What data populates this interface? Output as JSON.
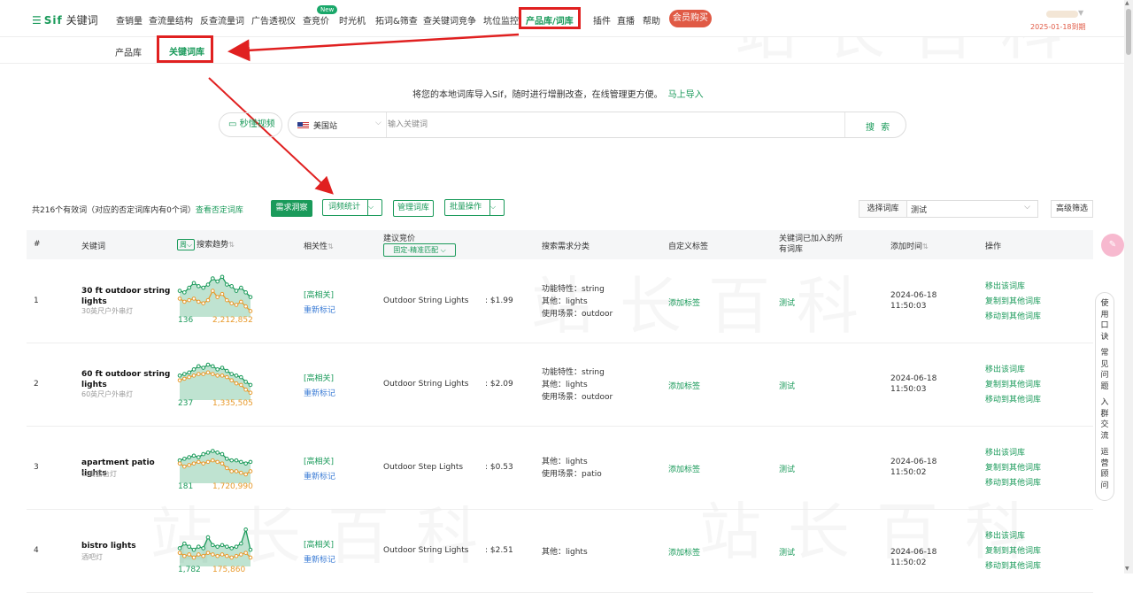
{
  "nav": {
    "logo_brand": "Sif",
    "logo_text": "关键词",
    "items": [
      "查销量",
      "查流量结构",
      "反查流量词",
      "广告透视仪",
      "查竞价",
      "时光机",
      "拓词&筛查",
      "查关键词竞争",
      "坑位监控",
      "产品库/词库",
      "插件",
      "直播",
      "帮助"
    ],
    "active_item": "产品库/词库",
    "new_badge": "New",
    "vip_button": "会员购买",
    "expire_text": "2025-01-18到期"
  },
  "subnav": {
    "items": [
      "产品库",
      "关键词库"
    ],
    "active": "关键词库"
  },
  "import_banner": {
    "text": "将您的本地词库导入Sif，随时进行增删改查，在线管理更方便。",
    "link": "马上导入"
  },
  "search": {
    "video_button": "秒懂视频",
    "site": "美国站",
    "placeholder": "输入关键词",
    "button": "搜 索"
  },
  "toolbar": {
    "total_text": "共216个有效词（对应的否定词库内有0个词）",
    "negative_link": "查看否定词库",
    "btn_demand": "需求洞察",
    "btn_freq": "词频统计",
    "btn_manage": "管理词库",
    "btn_batch": "批量操作",
    "select_label": "选择词库",
    "select_value": "测试",
    "advanced": "高级筛选"
  },
  "table": {
    "headers": {
      "index": "#",
      "keyword": "关键词",
      "trend_period": "周",
      "trend": "搜索趋势",
      "relevance": "相关性",
      "bid": "建议竞价",
      "bid_mode": "固定-精准匹配",
      "demand": "搜索需求分类",
      "tags": "自定义标签",
      "libs": "关键词已加入的所有词库",
      "added": "添加时间",
      "ops": "操作"
    },
    "rows": [
      {
        "index": "1",
        "keyword": "30 ft outdoor string lights",
        "keyword_cn": "30英尺户外串灯",
        "rank": "136",
        "volume": "2,212,852",
        "trend_green": [
          30,
          28,
          34,
          40,
          36,
          34,
          38,
          46,
          42,
          48,
          38,
          36,
          30,
          34,
          28,
          22
        ],
        "trend_orange": [
          20,
          16,
          18,
          20,
          16,
          14,
          18,
          30,
          22,
          26,
          18,
          14,
          12,
          16,
          10,
          4
        ],
        "relevance": "[高相关]",
        "remark": "重新标记",
        "category": "Outdoor String Lights",
        "bid": "$1.99",
        "demand": [
          "功能特性：string",
          "其他：lights",
          "使用场景：outdoor"
        ],
        "tag": "添加标签",
        "lib": "测试",
        "date": "2024-06-18",
        "time": "11:50:03"
      },
      {
        "index": "2",
        "keyword": "60 ft outdoor string lights",
        "keyword_cn": "60英尺户外串灯",
        "rank": "237",
        "volume": "1,335,505",
        "trend_green": [
          28,
          30,
          32,
          36,
          40,
          38,
          42,
          40,
          36,
          38,
          34,
          30,
          28,
          26,
          20,
          16
        ],
        "trend_orange": [
          22,
          24,
          26,
          28,
          30,
          30,
          32,
          30,
          28,
          28,
          26,
          22,
          18,
          16,
          10,
          6
        ],
        "relevance": "[高相关]",
        "remark": "重新标记",
        "category": "Outdoor String Lights",
        "bid": "$2.09",
        "demand": [
          "功能特性：string",
          "其他：lights",
          "使用场景：outdoor"
        ],
        "tag": "添加标签",
        "lib": "测试",
        "date": "2024-06-18",
        "time": "11:50:03"
      },
      {
        "index": "3",
        "keyword": "apartment patio lights",
        "keyword_cn": "公寓露台灯",
        "rank": "181",
        "volume": "1,720,990",
        "trend_green": [
          26,
          28,
          30,
          32,
          30,
          34,
          36,
          38,
          36,
          34,
          28,
          26,
          26,
          24,
          22,
          24
        ],
        "trend_orange": [
          22,
          18,
          20,
          22,
          24,
          22,
          24,
          26,
          24,
          22,
          16,
          12,
          12,
          10,
          8,
          12
        ],
        "relevance": "[高相关]",
        "remark": "重新标记",
        "category": "Outdoor Step Lights",
        "bid": "$0.53",
        "demand": [
          "其他：lights",
          "使用场景：patio"
        ],
        "tag": "添加标签",
        "lib": "测试",
        "date": "2024-06-18",
        "time": "11:50:02"
      },
      {
        "index": "4",
        "keyword": "bistro lights",
        "keyword_cn": "酒吧灯",
        "rank": "1,782",
        "volume": "175,860",
        "trend_green": [
          20,
          26,
          22,
          18,
          22,
          20,
          34,
          24,
          22,
          24,
          22,
          20,
          22,
          26,
          44,
          18
        ],
        "trend_orange": [
          14,
          10,
          12,
          8,
          12,
          10,
          14,
          12,
          10,
          12,
          10,
          8,
          10,
          12,
          14,
          8
        ],
        "relevance": "[高相关]",
        "remark": "重新标记",
        "category": "Outdoor String Lights",
        "bid": "$2.51",
        "demand": [
          "其他：lights"
        ],
        "tag": "添加标签",
        "lib": "测试",
        "date": "2024-06-18",
        "time": "11:50:02"
      }
    ],
    "ops": [
      "移出该词库",
      "复制到其他词库",
      "移动到其他词库"
    ]
  },
  "sidebar": {
    "groups": [
      "使用口诀",
      "常见问题",
      "入群交流",
      "运营顾问"
    ]
  },
  "watermark": "站长百科",
  "colors": {
    "accent": "#1a9a5a",
    "orange": "#e89a2c",
    "red_annotation": "#e02020",
    "vip": "#e05a45"
  }
}
